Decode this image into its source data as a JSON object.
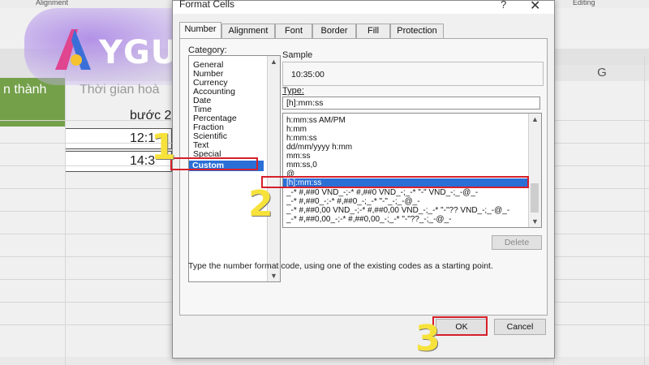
{
  "excel": {
    "ribbon_groups": [
      "Alignment",
      "Editing"
    ],
    "column_g": "G",
    "header_cell_1": "n thành",
    "header_cell_2_line1": "Thời gian hoà",
    "header_cell_2_line2": "bước 2",
    "row1_value": "12:1",
    "row2_value": "14:3"
  },
  "logo": {
    "text": "YGUAI"
  },
  "dialog": {
    "title": "Format Cells",
    "help_label": "?",
    "close_label": "✕",
    "tabs": [
      "Number",
      "Alignment",
      "Font",
      "Border",
      "Fill",
      "Protection"
    ],
    "active_tab": "Number",
    "category_label": "Category:",
    "categories": [
      "General",
      "Number",
      "Currency",
      "Accounting",
      "Date",
      "Time",
      "Percentage",
      "Fraction",
      "Scientific",
      "Text",
      "Special",
      "Custom"
    ],
    "selected_category": "Custom",
    "sample_label": "Sample",
    "sample_value": "10:35:00",
    "type_label": "Type:",
    "type_value": "[h]:mm:ss",
    "format_codes": [
      "h:mm:ss AM/PM",
      "h:mm",
      "h:mm:ss",
      "dd/mm/yyyy h:mm",
      "mm:ss",
      "mm:ss,0",
      "@",
      "[h]:mm:ss",
      "_-* #,##0 VND_-;-* #,##0 VND_-;_-* \"-\" VND_-;_-@_-",
      "_-* #,##0_-;-* #,##0_-;_-* \"-\"_-;_-@_-",
      "_-* #,##0,00 VND_-;-* #,##0,00 VND_-;_-* \"-\"?? VND_-;_-@_-",
      "_-* #,##0,00_-;-* #,##0,00_-;_-* \"-\"??_-;_-@_-"
    ],
    "selected_format": "[h]:mm:ss",
    "delete_label": "Delete",
    "hint_text": "Type the number format code, using one of the existing codes as a starting point.",
    "ok_label": "OK",
    "cancel_label": "Cancel"
  },
  "steps": [
    "1",
    "2",
    "3"
  ],
  "colors": {
    "highlight": "#d61f2a",
    "step_number": "#f7e23b",
    "selection": "#2a6fd6",
    "header_green": "#74a04a"
  }
}
